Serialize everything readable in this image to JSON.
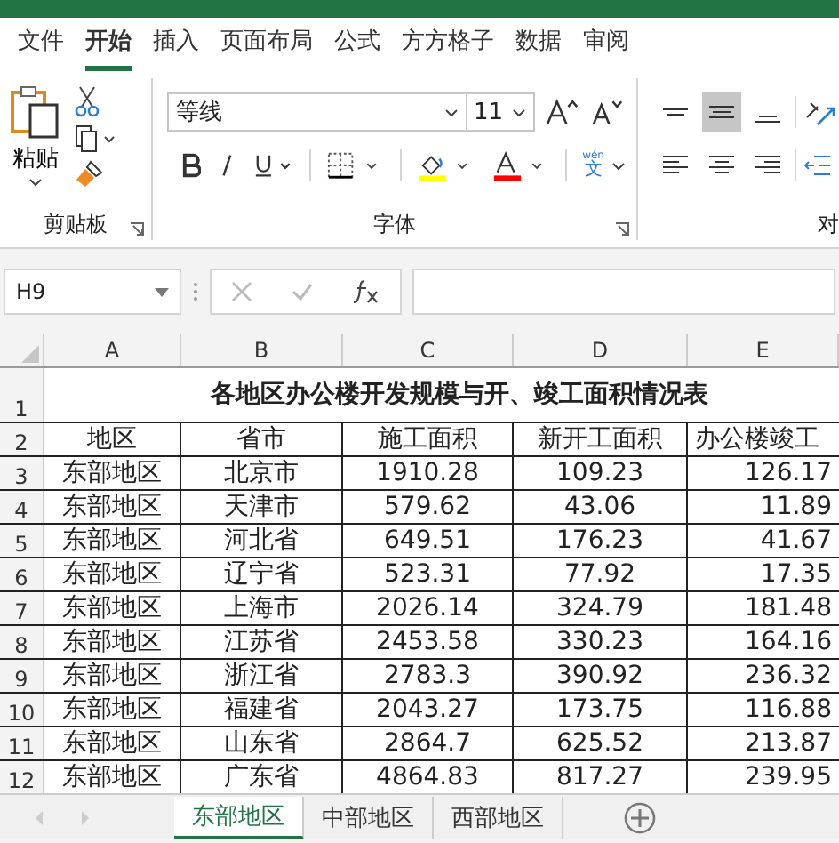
{
  "ribbon_tabs": [
    {
      "label": "文件",
      "selected": false
    },
    {
      "label": "开始",
      "selected": true
    },
    {
      "label": "插入",
      "selected": false
    },
    {
      "label": "页面布局",
      "selected": false
    },
    {
      "label": "公式",
      "selected": false
    },
    {
      "label": "方方格子",
      "selected": false
    },
    {
      "label": "数据",
      "selected": false
    },
    {
      "label": "审阅",
      "selected": false
    }
  ],
  "clipboard": {
    "paste_label": "粘贴",
    "group_label": "剪贴板"
  },
  "font": {
    "font_name": "等线",
    "font_size": "11",
    "phonetic_label": "wén",
    "phonetic_char": "文",
    "group_label": "字体"
  },
  "alignment": {
    "group_label": "对",
    "vertical_align": [
      {
        "selected": false
      },
      {
        "selected": true
      },
      {
        "selected": false
      }
    ]
  },
  "formula_bar": {
    "name_box": "H9"
  },
  "sheet": {
    "columns": [
      "A",
      "B",
      "C",
      "D",
      "E"
    ],
    "title_row": "1",
    "title": "各地区办公楼开发规模与开、竣工面积情况表",
    "header_row": "2",
    "headers": [
      "地区",
      "省市",
      "施工面积",
      "新开工面积",
      "办公楼竣工"
    ],
    "rows": [
      {
        "num": "3",
        "cells": [
          "东部地区",
          "北京市",
          "1910.28",
          "109.23",
          "126.17"
        ]
      },
      {
        "num": "4",
        "cells": [
          "东部地区",
          "天津市",
          "579.62",
          "43.06",
          "11.89"
        ]
      },
      {
        "num": "5",
        "cells": [
          "东部地区",
          "河北省",
          "649.51",
          "176.23",
          "41.67"
        ]
      },
      {
        "num": "6",
        "cells": [
          "东部地区",
          "辽宁省",
          "523.31",
          "77.92",
          "17.35"
        ]
      },
      {
        "num": "7",
        "cells": [
          "东部地区",
          "上海市",
          "2026.14",
          "324.79",
          "181.48"
        ]
      },
      {
        "num": "8",
        "cells": [
          "东部地区",
          "江苏省",
          "2453.58",
          "330.23",
          "164.16"
        ]
      },
      {
        "num": "9",
        "cells": [
          "东部地区",
          "浙江省",
          "2783.3",
          "390.92",
          "236.32"
        ]
      },
      {
        "num": "10",
        "cells": [
          "东部地区",
          "福建省",
          "2043.27",
          "173.75",
          "116.88"
        ]
      },
      {
        "num": "11",
        "cells": [
          "东部地区",
          "山东省",
          "2864.7",
          "625.52",
          "213.87"
        ]
      },
      {
        "num": "12",
        "cells": [
          "东部地区",
          "广东省",
          "4864.83",
          "817.27",
          "239.95"
        ]
      }
    ]
  },
  "sheet_tabs": [
    {
      "label": "东部地区",
      "selected": true
    },
    {
      "label": "中部地区",
      "selected": false
    },
    {
      "label": "西部地区",
      "selected": false
    }
  ]
}
